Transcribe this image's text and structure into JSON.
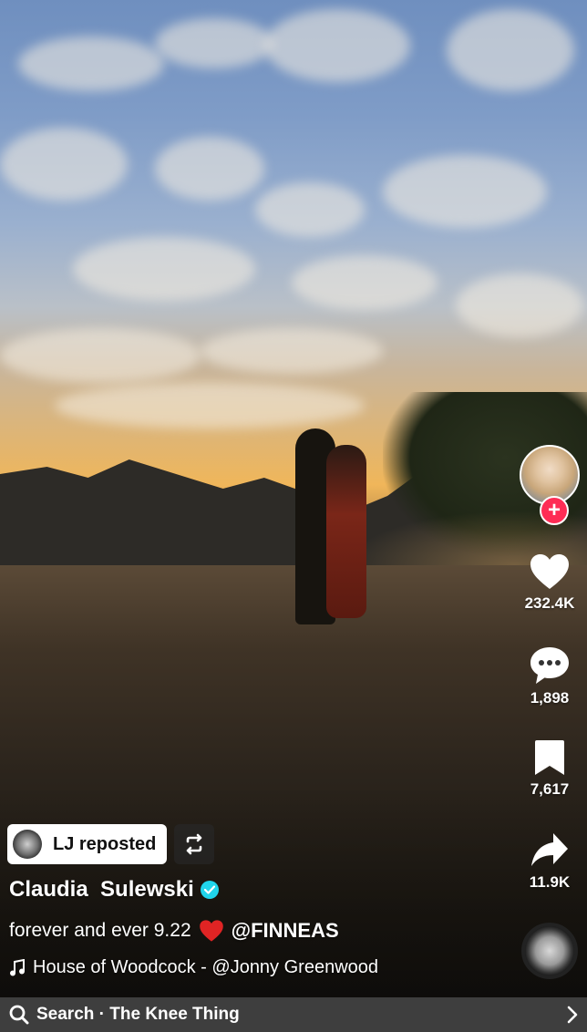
{
  "rail": {
    "likes": "232.4K",
    "comments": "1,898",
    "saves": "7,617",
    "shares": "11.9K",
    "follow_symbol": "+"
  },
  "repost": {
    "label": "LJ reposted"
  },
  "post": {
    "author_first": "Claudia",
    "author_last": "Sulewski",
    "caption": "forever and ever 9.22",
    "caption_emoji": "❤️",
    "mention": "@FINNEAS",
    "music": "House of Woodcock - @Jonny Greenwood"
  },
  "search": {
    "label": "Search · The Knee Thing"
  },
  "colors": {
    "accent": "#fe2c55",
    "verified": "#20d5ec"
  }
}
